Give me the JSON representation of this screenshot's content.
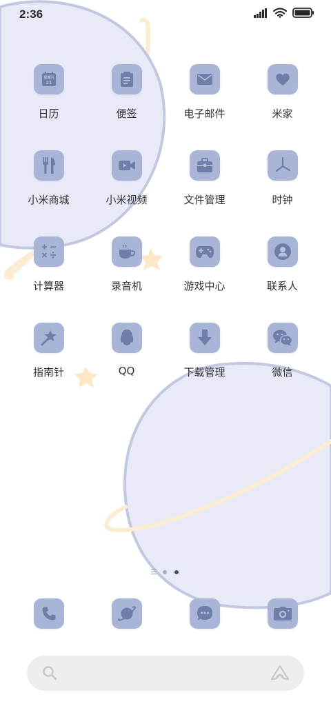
{
  "status_bar": {
    "time": "2:36",
    "icons": [
      "signal-icon",
      "wifi-icon",
      "battery-icon"
    ]
  },
  "home": {
    "apps": [
      {
        "label": "日历",
        "icon": "calendar-icon",
        "calendar_weekday": "星期六",
        "calendar_day": "21"
      },
      {
        "label": "便签",
        "icon": "notes-icon"
      },
      {
        "label": "电子邮件",
        "icon": "mail-icon"
      },
      {
        "label": "米家",
        "icon": "heart-icon"
      },
      {
        "label": "小米商城",
        "icon": "fork-knife-icon"
      },
      {
        "label": "小米视频",
        "icon": "video-camera-icon"
      },
      {
        "label": "文件管理",
        "icon": "toolbox-icon"
      },
      {
        "label": "时钟",
        "icon": "clock-icon"
      },
      {
        "label": "计算器",
        "icon": "calculator-icon"
      },
      {
        "label": "录音机",
        "icon": "coffee-cup-icon"
      },
      {
        "label": "游戏中心",
        "icon": "gamepad-icon"
      },
      {
        "label": "联系人",
        "icon": "person-icon"
      },
      {
        "label": "指南针",
        "icon": "magic-wand-icon"
      },
      {
        "label": "QQ",
        "icon": "qq-penguin-icon"
      },
      {
        "label": "下载管理",
        "icon": "download-arrow-icon"
      },
      {
        "label": "微信",
        "icon": "wechat-icon"
      }
    ]
  },
  "page_indicator": {
    "pages": 2,
    "current": 2
  },
  "dock": [
    {
      "icon": "phone-icon"
    },
    {
      "icon": "browser-planet-icon"
    },
    {
      "icon": "messages-icon"
    },
    {
      "icon": "camera-icon"
    }
  ],
  "search": {
    "icon": "search-icon",
    "assistant_icon": "xiaoai-assistant-icon"
  },
  "theme": {
    "icon_bg": "#a8b5d6",
    "icon_glyph": "#6e7ea8",
    "planet_fill": "#e9eaf8",
    "planet_stroke": "#c3c8e2",
    "ring_color": "#fcecd2",
    "star_color": "#fde7c4"
  }
}
